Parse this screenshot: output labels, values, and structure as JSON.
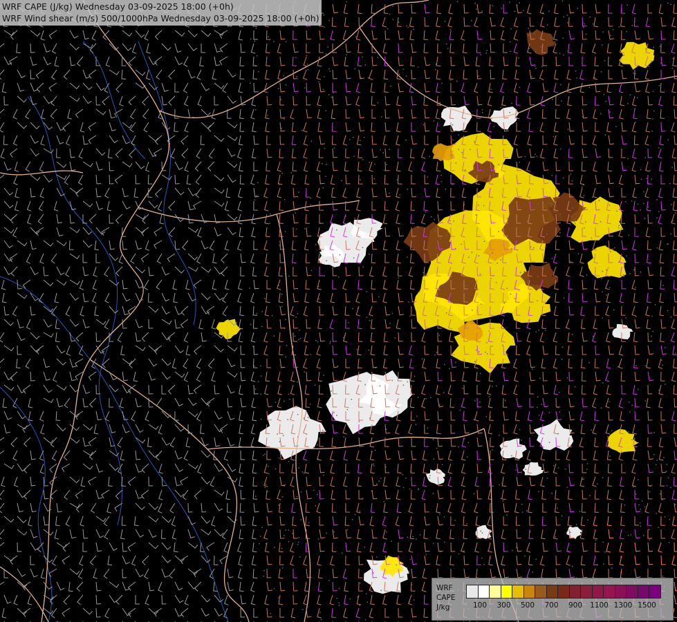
{
  "titles": {
    "line1": "WRF CAPE (J/kg) Wednesday 03-09-2025 18:00 (+0h)",
    "line2": "WRF Wind shear (m/s) 500/1000hPa Wednesday 03-09-2025 18:00 (+0h)"
  },
  "legend": {
    "label_model": "WRF",
    "label_field": "CAPE",
    "label_unit": "J/kg",
    "tick_labels": [
      "100",
      "300",
      "500",
      "700",
      "900",
      "1100",
      "1300",
      "1500"
    ],
    "colors": [
      "#e8e8e8",
      "#ffffff",
      "#ffff99",
      "#ffff00",
      "#e6c000",
      "#c8860a",
      "#9a5a1e",
      "#7a3a14",
      "#7a2818",
      "#802030",
      "#8a1e3c",
      "#901848",
      "#961450",
      "#8c1058",
      "#800c60",
      "#780870",
      "#7a0080"
    ]
  },
  "map_colors": {
    "background": "#000000",
    "border_lines": "#e6b48c",
    "river_lines": "#2b56b8",
    "barb_low": "#9b9b9b",
    "barb_mid": "#c87864",
    "barb_high": "#d23ae6",
    "cape_white": "#ffffff",
    "cape_yellow": "#ffe600",
    "cape_orange": "#e6a000",
    "cape_brown": "#7a3c14"
  }
}
